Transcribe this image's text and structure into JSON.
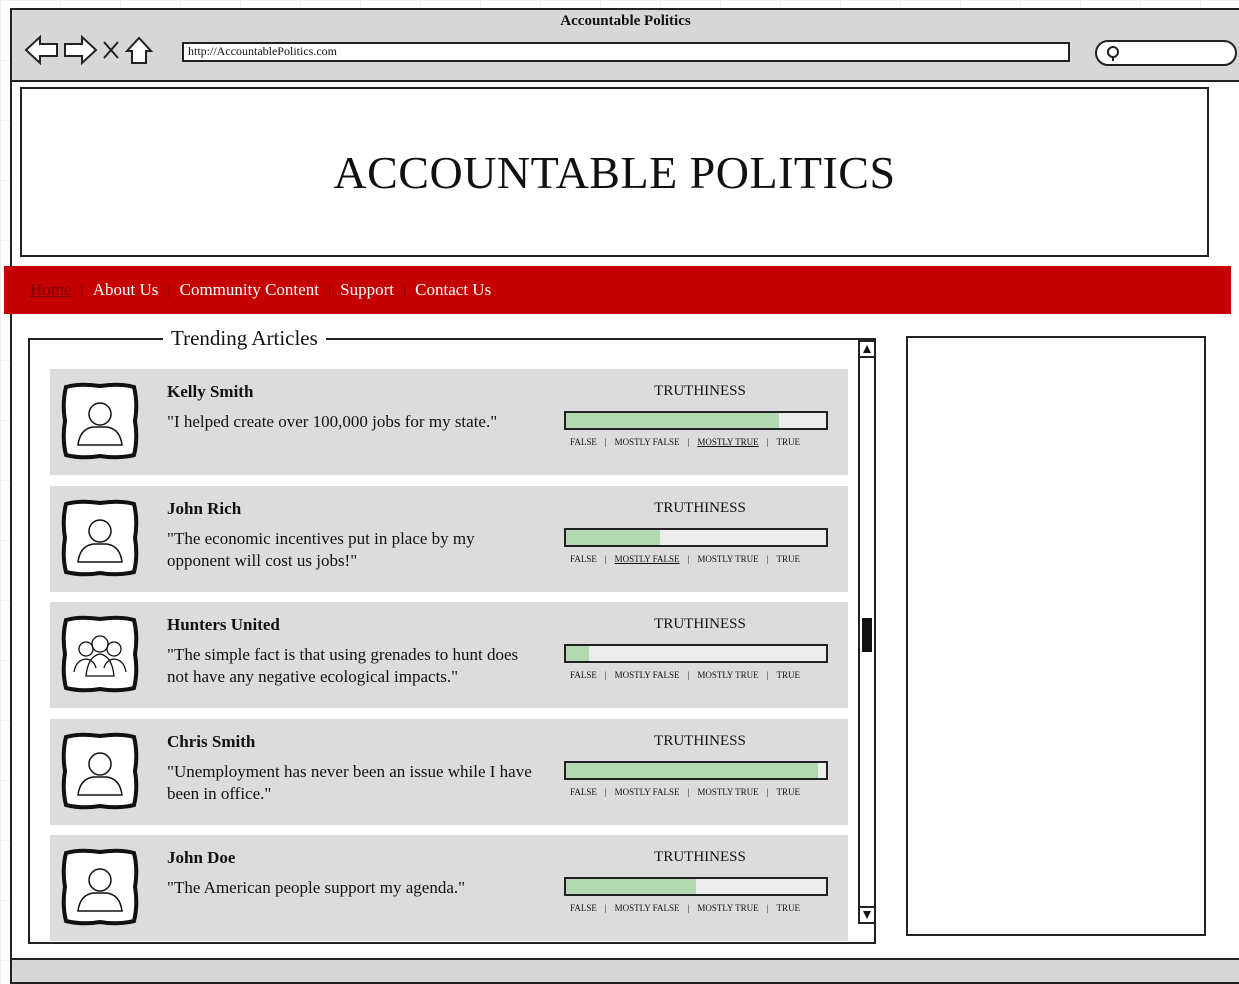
{
  "browser": {
    "title": "Accountable Politics",
    "url": "http://AccountablePolitics.com"
  },
  "banner": {
    "title": "ACCOUNTABLE POLITICS"
  },
  "nav": {
    "items": [
      {
        "label": "Home",
        "active": true
      },
      {
        "label": "About Us"
      },
      {
        "label": "Community Content"
      },
      {
        "label": "Support"
      },
      {
        "label": "Contact Us"
      }
    ],
    "separator": "|"
  },
  "trending": {
    "title": "Trending Articles",
    "truth_title": "TRUTHINESS",
    "scale": [
      "FALSE",
      "MOSTLY FALSE",
      "MOSTLY TRUE",
      "TRUE"
    ],
    "articles": [
      {
        "name": "Kelly Smith",
        "quote": "\"I helped create over 100,000 jobs for my state.\"",
        "truthiness": 0.82,
        "rating": "MOSTLY TRUE",
        "avatar": "person-icon"
      },
      {
        "name": "John Rich",
        "quote": "\"The economic incentives put in place by my opponent will cost us jobs!\"",
        "truthiness": 0.36,
        "rating": "MOSTLY FALSE",
        "avatar": "person-icon"
      },
      {
        "name": "Hunters United",
        "quote": "\"The simple fact is that using grenades to hunt does not have any negative ecological impacts.\"",
        "truthiness": 0.09,
        "rating": "FALSE",
        "avatar": "group-icon"
      },
      {
        "name": "Chris Smith",
        "quote": "\"Unemployment has never been an issue while I have been in office.\"",
        "truthiness": 0.97,
        "rating": "TRUE",
        "avatar": "person-icon"
      },
      {
        "name": "John Doe",
        "quote": "\"The American people support my agenda.\"",
        "truthiness": 0.5,
        "rating": "",
        "avatar": "person-icon"
      }
    ]
  },
  "colors": {
    "nav_bg": "#c40000",
    "truth_fill": "#b3d9b3",
    "card_bg": "#dcdcdc"
  }
}
